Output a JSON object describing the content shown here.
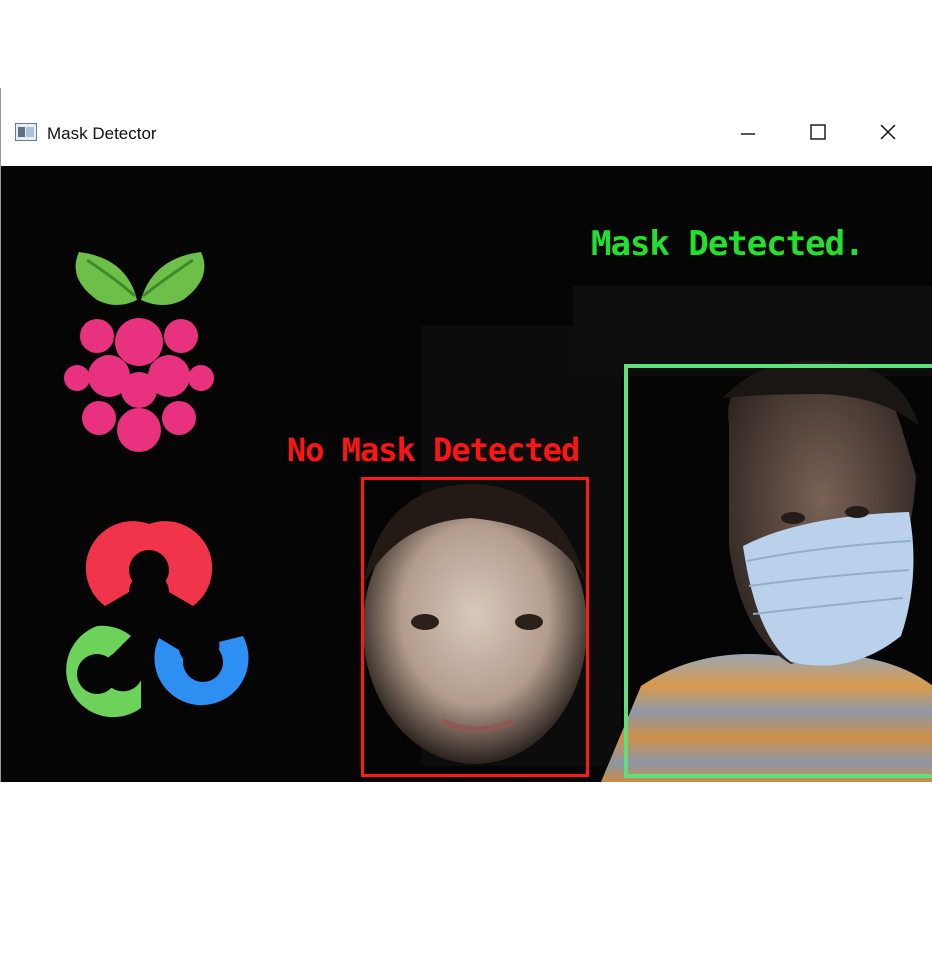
{
  "window": {
    "title": "Mask Detector",
    "controls": {
      "minimize": "minimize-icon",
      "maximize": "maximize-icon",
      "close": "close-icon"
    }
  },
  "detections": [
    {
      "label": "Mask Detected.",
      "color": "#22e02c",
      "box_color": "#5fe07a"
    },
    {
      "label": "No Mask Detected",
      "color": "#ff1414",
      "box_color": "#ff1a1a"
    }
  ],
  "logos": [
    "raspberry-pi-logo",
    "opencv-logo"
  ],
  "colors": {
    "background": "#050505",
    "rpi_berry": "#e8327f",
    "rpi_leaf": "#6cc04a",
    "opencv_red": "#f2344a",
    "opencv_green": "#6cd25a",
    "opencv_blue": "#2e8ff2"
  }
}
